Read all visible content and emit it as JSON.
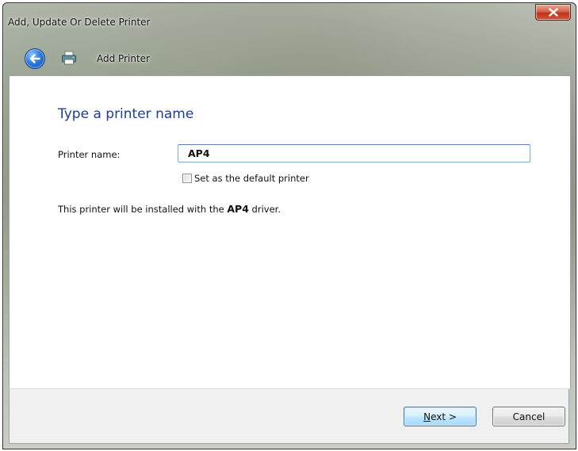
{
  "window": {
    "title": "Add, Update Or Delete Printer"
  },
  "nav": {
    "title": "Add Printer",
    "back_icon": "back-arrow-icon",
    "printer_icon": "printer-icon"
  },
  "content": {
    "heading": "Type a printer name",
    "printer_name_label": "Printer name:",
    "printer_name_value": "AP4",
    "default_checkbox_label": "Set as the default printer",
    "default_checkbox_checked": false,
    "info_prefix": "This printer will be installed with the ",
    "info_driver": "AP4",
    "info_suffix": " driver."
  },
  "footer": {
    "next_label_mnemonic": "N",
    "next_label_rest": "ext >",
    "cancel_label": "Cancel"
  },
  "colors": {
    "heading": "#1e3b9b",
    "close_button": "#c1321b",
    "next_button_border": "#3c7fb1"
  }
}
